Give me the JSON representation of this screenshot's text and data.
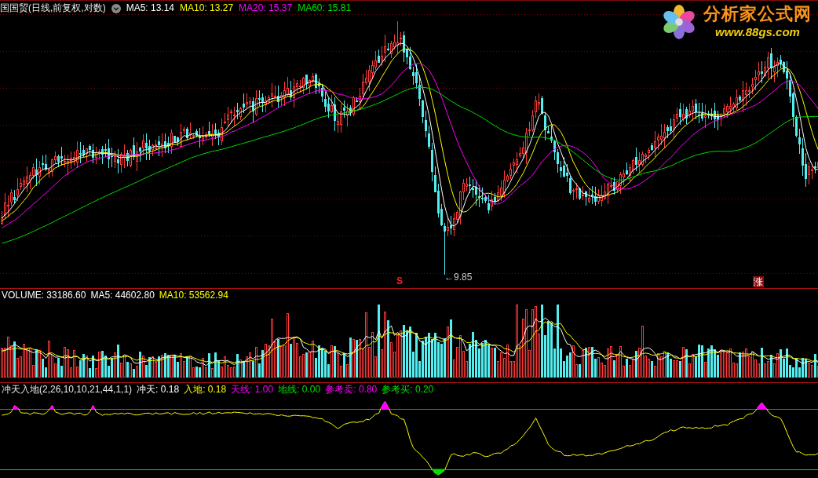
{
  "main_panel": {
    "title": "国国贸(日线,前复权,对数)",
    "indicators": [
      {
        "text": "MA5: 13.14",
        "color": "#ffffff"
      },
      {
        "text": "MA10: 13.27",
        "color": "#ffff00"
      },
      {
        "text": "MA20: 15.37",
        "color": "#ff00ff"
      },
      {
        "text": "MA60: 15.81",
        "color": "#00e000"
      }
    ],
    "markers": [
      {
        "kind": "signal",
        "text": "S"
      },
      {
        "kind": "price_label",
        "text": "←9.85"
      },
      {
        "kind": "badge",
        "text": "涨"
      }
    ]
  },
  "logo": {
    "name": "分析家公式网",
    "url": "www.88gs.com"
  },
  "volume_panel": {
    "indicators": [
      {
        "text": "VOLUME: 33186.60",
        "color": "#ffffff"
      },
      {
        "text": "MA5: 44602.80",
        "color": "#ffffff"
      },
      {
        "text": "MA10: 53562.94",
        "color": "#ffff00"
      }
    ]
  },
  "indicator_panel": {
    "title": "冲天入地(2,26,10,10,21,44,1,1)",
    "indicators": [
      {
        "text": "冲天: 0.18",
        "color": "#ffffff"
      },
      {
        "text": "入地: 0.18",
        "color": "#ffff00"
      },
      {
        "text": "天线: 1.00",
        "color": "#ff00ff"
      },
      {
        "text": "地线: 0.00",
        "color": "#00e000"
      },
      {
        "text": "参考卖: 0.80",
        "color": "#ff00ff"
      },
      {
        "text": "参考买: 0.20",
        "color": "#00e000"
      }
    ]
  }
}
